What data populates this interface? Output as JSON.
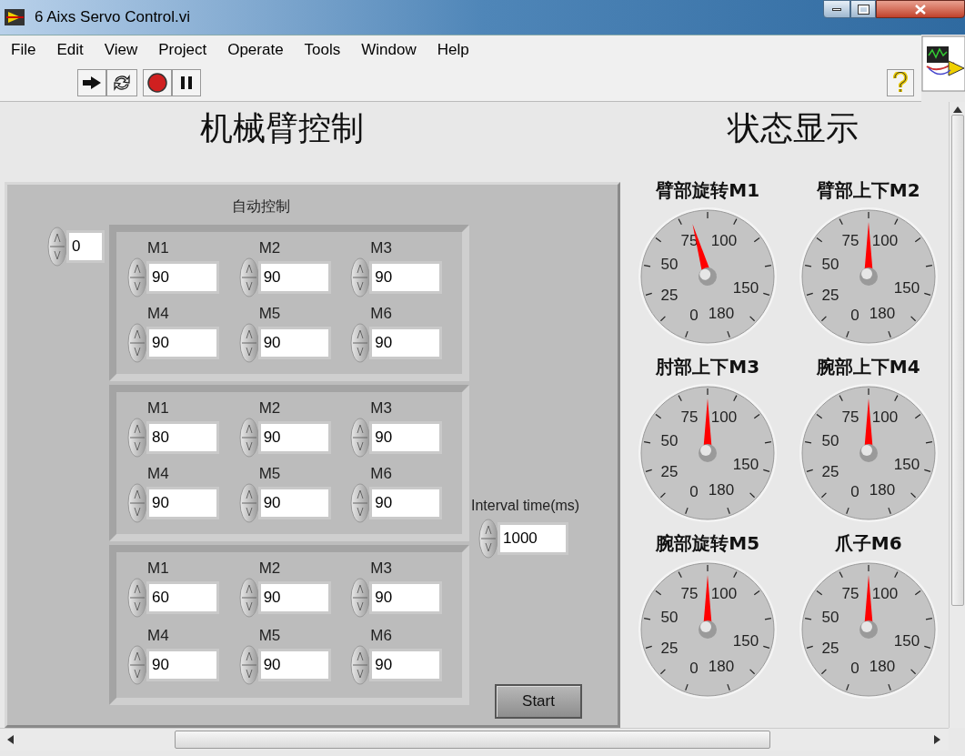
{
  "window": {
    "title": "6 Aixs Servo Control.vi"
  },
  "menu": [
    "File",
    "Edit",
    "View",
    "Project",
    "Operate",
    "Tools",
    "Window",
    "Help"
  ],
  "headings": {
    "control": "机械臂控制",
    "status": "状态显示"
  },
  "auto_control": {
    "label": "自动控制",
    "index": "0",
    "clusters": [
      {
        "fields": [
          {
            "label": "M1",
            "value": "90"
          },
          {
            "label": "M2",
            "value": "90"
          },
          {
            "label": "M3",
            "value": "90"
          },
          {
            "label": "M4",
            "value": "90"
          },
          {
            "label": "M5",
            "value": "90"
          },
          {
            "label": "M6",
            "value": "90"
          }
        ]
      },
      {
        "fields": [
          {
            "label": "M1",
            "value": "80"
          },
          {
            "label": "M2",
            "value": "90"
          },
          {
            "label": "M3",
            "value": "90"
          },
          {
            "label": "M4",
            "value": "90"
          },
          {
            "label": "M5",
            "value": "90"
          },
          {
            "label": "M6",
            "value": "90"
          }
        ]
      },
      {
        "fields": [
          {
            "label": "M1",
            "value": "60"
          },
          {
            "label": "M2",
            "value": "90"
          },
          {
            "label": "M3",
            "value": "90"
          },
          {
            "label": "M4",
            "value": "90"
          },
          {
            "label": "M5",
            "value": "90"
          },
          {
            "label": "M6",
            "value": "90"
          }
        ]
      }
    ],
    "interval": {
      "label": "Interval time(ms)",
      "value": "1000"
    },
    "start_button": "Start"
  },
  "gauges": [
    {
      "title": "臂部旋转M1",
      "level": 0.45,
      "tick_labels": [
        "0",
        "25",
        "50",
        "75",
        "100",
        "150",
        "180"
      ]
    },
    {
      "title": "臂部上下M2",
      "level": 0.5,
      "tick_labels": [
        "0",
        "25",
        "50",
        "75",
        "100",
        "150",
        "180"
      ]
    },
    {
      "title": "肘部上下M3",
      "level": 0.5,
      "tick_labels": [
        "0",
        "25",
        "50",
        "75",
        "100",
        "150",
        "180"
      ]
    },
    {
      "title": "腕部上下M4",
      "level": 0.5,
      "tick_labels": [
        "0",
        "25",
        "50",
        "75",
        "100",
        "150",
        "180"
      ]
    },
    {
      "title": "腕部旋转M5",
      "level": 0.5,
      "tick_labels": [
        "0",
        "25",
        "50",
        "75",
        "100",
        "150",
        "180"
      ]
    },
    {
      "title": "爪子M6",
      "level": 0.5,
      "tick_labels": [
        "0",
        "25",
        "50",
        "75",
        "100",
        "150",
        "180"
      ]
    }
  ]
}
